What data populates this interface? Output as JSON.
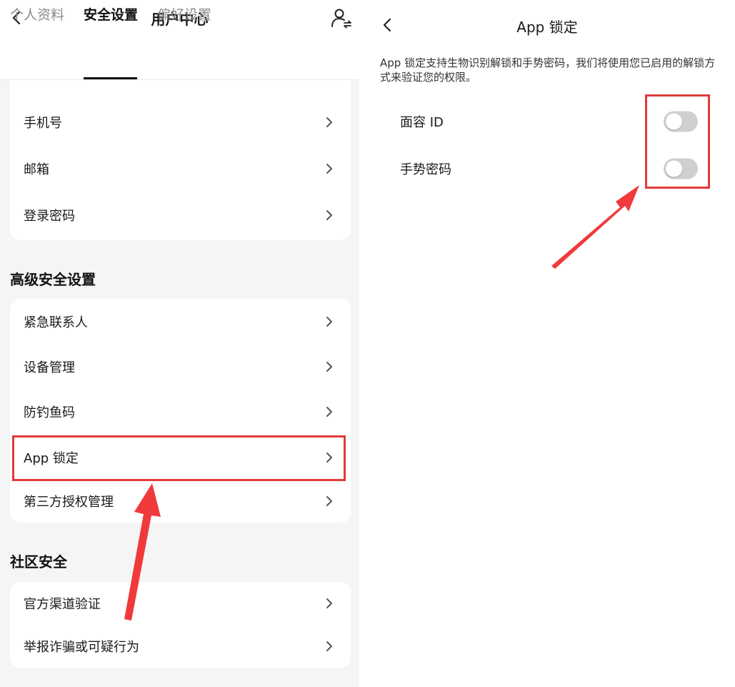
{
  "left": {
    "title": "用户中心",
    "tabs": [
      {
        "label": "个人资料",
        "active": false
      },
      {
        "label": "安全设置",
        "active": true
      },
      {
        "label": "偏好设置",
        "active": false
      }
    ],
    "account_items": [
      {
        "label": "手机号"
      },
      {
        "label": "邮箱"
      },
      {
        "label": "登录密码"
      }
    ],
    "advanced_title": "高级安全设置",
    "advanced_items": [
      {
        "label": "紧急联系人"
      },
      {
        "label": "设备管理"
      },
      {
        "label": "防钓鱼码"
      },
      {
        "label": "App 锁定"
      },
      {
        "label": "第三方授权管理"
      }
    ],
    "community_title": "社区安全",
    "community_items": [
      {
        "label": "官方渠道验证"
      },
      {
        "label": "举报诈骗或可疑行为"
      }
    ]
  },
  "right": {
    "title": "App 锁定",
    "description": "App 锁定支持生物识别解锁和手势密码，我们将使用您已启用的解锁方式来验证您的权限。",
    "toggles": [
      {
        "label": "面容 ID",
        "on": false
      },
      {
        "label": "手势密码",
        "on": false
      }
    ]
  },
  "colors": {
    "highlight": "#e23b3b",
    "arrow": "#f0393b",
    "toggle_off": "#cfcfcf",
    "background": "#f5f5f5"
  },
  "icons": [
    "back-chevron-icon",
    "user-switch-icon",
    "chevron-right-icon"
  ]
}
